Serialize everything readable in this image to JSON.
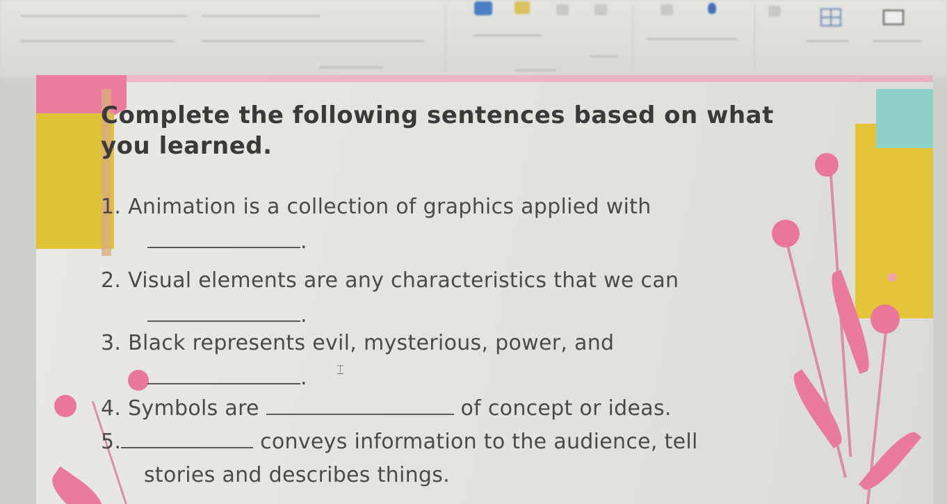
{
  "slide": {
    "instructions": "Complete the following sentences based on what you learned.",
    "items": [
      {
        "num": "1.",
        "before": "Animation is a collection of graphics applied with",
        "after": "."
      },
      {
        "num": "2.",
        "before": "Visual elements are any characteristics that we can",
        "after": "."
      },
      {
        "num": "3.",
        "before": "Black represents evil, mysterious, power, and",
        "after": "."
      },
      {
        "num": "4.",
        "before": "Symbols are",
        "after": "of concept or ideas."
      },
      {
        "num": "5.",
        "before": "",
        "after": "conveys information to the audience, tell",
        "cont": "stories and describes things."
      }
    ]
  },
  "colors": {
    "pink": "#ec7c9d",
    "yellow": "#dfc235",
    "teal": "#8ed1c8",
    "text": "#3a3a3a"
  },
  "icons": [
    "shapes-icon",
    "lightbulb-icon",
    "layout-grid-icon",
    "presenter-screen-icon",
    "arrange-icon"
  ]
}
